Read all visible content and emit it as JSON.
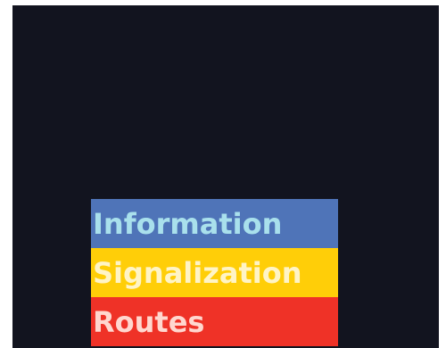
{
  "menu": {
    "items": [
      {
        "label": "Information",
        "background": "#4f74b8",
        "text_color": "#a9e0ec"
      },
      {
        "label": "Signalization",
        "background": "#ffce08",
        "text_color": "#fff4c6"
      },
      {
        "label": "Routes",
        "background": "#ef3227",
        "text_color": "#ffd7cf"
      }
    ]
  },
  "colors": {
    "screen_background": "#12141f",
    "frame_background": "#ffffff"
  }
}
